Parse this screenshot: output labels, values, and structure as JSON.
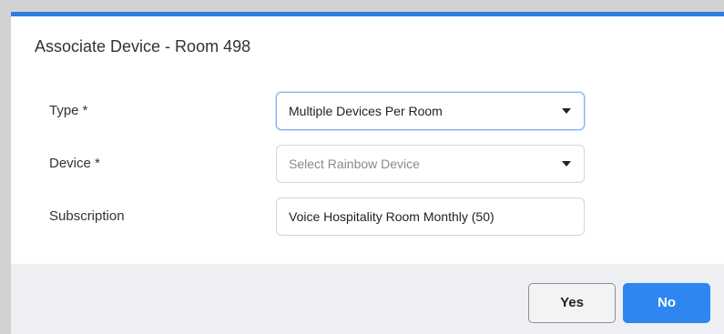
{
  "dialog": {
    "title": "Associate Device - Room 498",
    "accent_color": "#2f7de1"
  },
  "form": {
    "type": {
      "label": "Type *",
      "value": "Multiple Devices Per Room",
      "focused": true
    },
    "device": {
      "label": "Device *",
      "placeholder": "Select Rainbow Device"
    },
    "subscription": {
      "label": "Subscription",
      "value": "Voice Hospitality Room Monthly (50)"
    }
  },
  "footer": {
    "yes_label": "Yes",
    "no_label": "No",
    "primary_color": "#2e86f0"
  },
  "icons": {
    "dropdown": "chevron-down-icon"
  }
}
